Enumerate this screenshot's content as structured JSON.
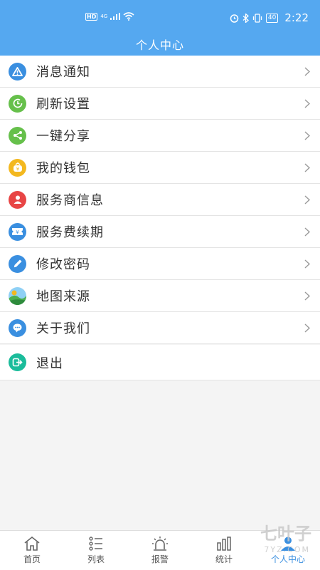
{
  "status_bar": {
    "hd": "HD",
    "network": "4G",
    "battery": "40",
    "time": "2:22"
  },
  "header": {
    "title": "个人中心"
  },
  "menu": [
    {
      "label": "消息通知",
      "icon": "warning-icon",
      "color": "#3a8fe0"
    },
    {
      "label": "刷新设置",
      "icon": "clock-icon",
      "color": "#66c04b"
    },
    {
      "label": "一键分享",
      "icon": "share-icon",
      "color": "#66c04b"
    },
    {
      "label": "我的钱包",
      "icon": "wallet-icon",
      "color": "#f3b81f"
    },
    {
      "label": "服务商信息",
      "icon": "person-icon",
      "color": "#e84545"
    },
    {
      "label": "服务费续期",
      "icon": "ticket-icon",
      "color": "#3a8fe0"
    },
    {
      "label": "修改密码",
      "icon": "pencil-icon",
      "color": "#3a8fe0"
    },
    {
      "label": "地图来源",
      "icon": "map-icon",
      "color": "#4caf50"
    },
    {
      "label": "关于我们",
      "icon": "chat-icon",
      "color": "#3a8fe0"
    }
  ],
  "exit": {
    "label": "退出",
    "icon": "exit-icon",
    "color": "#1bbc9b"
  },
  "tabs": [
    {
      "label": "首页",
      "icon": "home-icon"
    },
    {
      "label": "列表",
      "icon": "list-icon"
    },
    {
      "label": "报警",
      "icon": "alarm-icon"
    },
    {
      "label": "统计",
      "icon": "stats-icon"
    },
    {
      "label": "个人中心",
      "icon": "user-icon",
      "active": true
    }
  ],
  "watermark": {
    "line1": "七叶子",
    "line2": "7YZ.COM"
  }
}
